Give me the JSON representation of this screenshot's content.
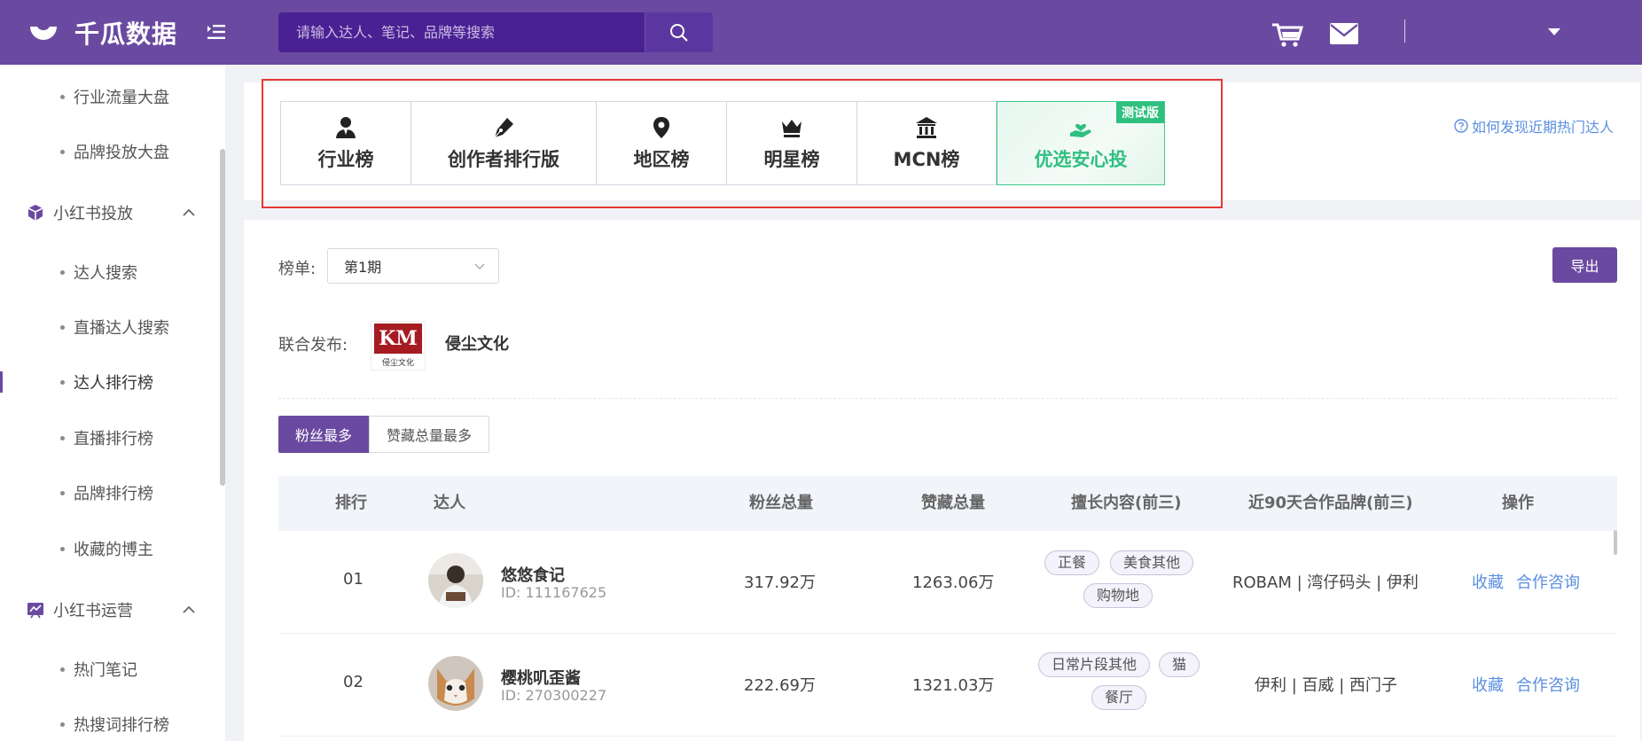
{
  "header": {
    "brand": "千瓜数据",
    "search_placeholder": "请输入达人、笔记、品牌等搜索"
  },
  "sidebar": {
    "items": [
      {
        "label": "行业流量大盘",
        "type": "item"
      },
      {
        "label": "品牌投放大盘",
        "type": "item"
      },
      {
        "label": "小红书投放",
        "type": "group"
      },
      {
        "label": "达人搜索",
        "type": "item"
      },
      {
        "label": "直播达人搜索",
        "type": "item"
      },
      {
        "label": "达人排行榜",
        "type": "item",
        "active": true
      },
      {
        "label": "直播排行榜",
        "type": "item"
      },
      {
        "label": "品牌排行榜",
        "type": "item"
      },
      {
        "label": "收藏的博主",
        "type": "item"
      },
      {
        "label": "小红书运营",
        "type": "group"
      },
      {
        "label": "热门笔记",
        "type": "item"
      },
      {
        "label": "热搜词排行榜",
        "type": "item"
      }
    ]
  },
  "rank_tabs": [
    {
      "label": "行业榜",
      "icon": "person-icon"
    },
    {
      "label": "创作者排行版",
      "icon": "pen-icon"
    },
    {
      "label": "地区榜",
      "icon": "location-pin-icon"
    },
    {
      "label": "明星榜",
      "icon": "crown-icon"
    },
    {
      "label": "MCN榜",
      "icon": "institution-icon"
    },
    {
      "label": "优选安心投",
      "icon": "hand-heart-icon",
      "badge": "测试版"
    }
  ],
  "help_link": "如何发现近期热门达人",
  "filters": {
    "list_label": "榜单:",
    "period_value": "第1期",
    "export_label": "导出",
    "copublish_label": "联合发布:",
    "partner_logo_text": "KM",
    "partner_logo_sub": "侵尘文化",
    "partner_name": "侵尘文化"
  },
  "sort_tabs": [
    {
      "label": "粉丝最多",
      "active": true
    },
    {
      "label": "赞藏总量最多",
      "active": false
    }
  ],
  "table": {
    "columns": [
      "排行",
      "达人",
      "粉丝总量",
      "赞藏总量",
      "擅长内容(前三)",
      "近90天合作品牌(前三)",
      "操作"
    ],
    "rows": [
      {
        "rank": "01",
        "name": "悠悠食记",
        "id": "ID:  111167625",
        "fans": "317.92万",
        "likes": "1263.06万",
        "tags": [
          "正餐",
          "美食其他",
          "购物地"
        ],
        "brands": "ROBAM | 湾仔码头 | 伊利",
        "op_collect": "收藏",
        "op_consult": "合作咨询"
      },
      {
        "rank": "02",
        "name": "樱桃叽歪酱",
        "id": "ID:  270300227",
        "fans": "222.69万",
        "likes": "1321.03万",
        "tags": [
          "日常片段其他",
          "猫",
          "餐厅"
        ],
        "brands": "伊利 | 百威 | 西门子",
        "op_collect": "收藏",
        "op_consult": "合作咨询"
      }
    ]
  },
  "colors": {
    "brand_purple": "#6a4aa0",
    "accent_green": "#2fbf7f",
    "link_blue": "#5b8fe0",
    "highlight_red": "#e53935"
  }
}
